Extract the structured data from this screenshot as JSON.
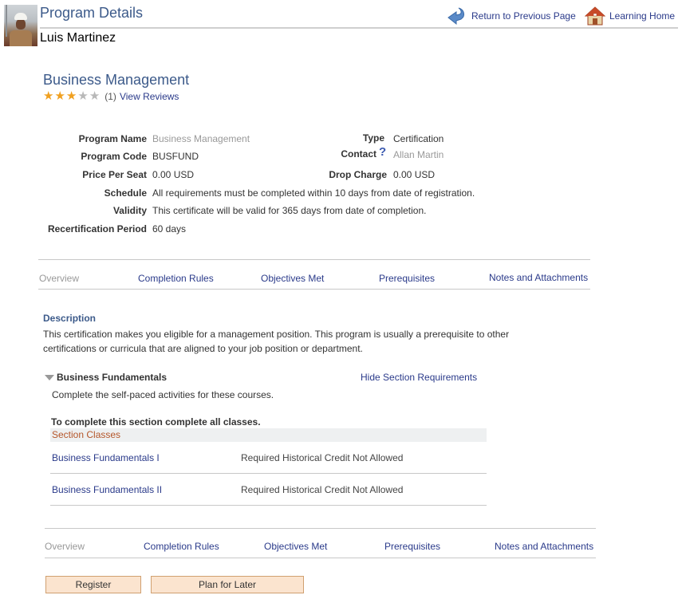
{
  "header": {
    "title": "Program Details",
    "user_name": "Luis Martinez",
    "return_link": "Return to Previous Page",
    "home_link": "Learning Home"
  },
  "program": {
    "title": "Business Management",
    "rating": {
      "value": 3,
      "max": 5,
      "count_text": "(1)",
      "reviews_link": "View Reviews"
    },
    "details": {
      "program_name_label": "Program Name",
      "program_name_value": "Business Management",
      "program_code_label": "Program Code",
      "program_code_value": "BUSFUND",
      "price_label": "Price Per Seat",
      "price_value": "0.00 USD",
      "schedule_label": "Schedule",
      "schedule_value": "All requirements must be completed within 10 days from date of registration.",
      "validity_label": "Validity",
      "validity_value": "This certificate will be valid for 365 days from date of completion.",
      "recert_label": "Recertification Period",
      "recert_value": "60 days",
      "type_label": "Type",
      "type_value": "Certification",
      "contact_label": "Contact",
      "contact_help": "?",
      "contact_value": "Allan Martin",
      "drop_label": "Drop Charge",
      "drop_value": "0.00 USD"
    }
  },
  "tabs": [
    {
      "label": "Overview",
      "active": true
    },
    {
      "label": "Completion Rules",
      "active": false
    },
    {
      "label": "Objectives Met",
      "active": false
    },
    {
      "label": "Prerequisites",
      "active": false
    },
    {
      "label": "Notes and Attachments",
      "active": false
    }
  ],
  "description": {
    "heading": "Description",
    "line1": "This certification makes you eligible for a management position. This program is usually a prerequisite to other",
    "line2": "certifications or curricula that are aligned to your job position or department."
  },
  "section": {
    "title": "Business Fundamentals",
    "toggle_link": "Hide Section Requirements",
    "instructions": "Complete the self-paced activities for these courses.",
    "rule": "To complete this section complete all classes.",
    "classes_heading": "Section Classes",
    "classes": [
      {
        "name": "Business Fundamentals I",
        "status": "Required Historical Credit Not Allowed"
      },
      {
        "name": "Business Fundamentals II",
        "status": "Required Historical Credit Not Allowed"
      }
    ]
  },
  "actions": {
    "register": "Register",
    "plan_later": "Plan for Later"
  }
}
